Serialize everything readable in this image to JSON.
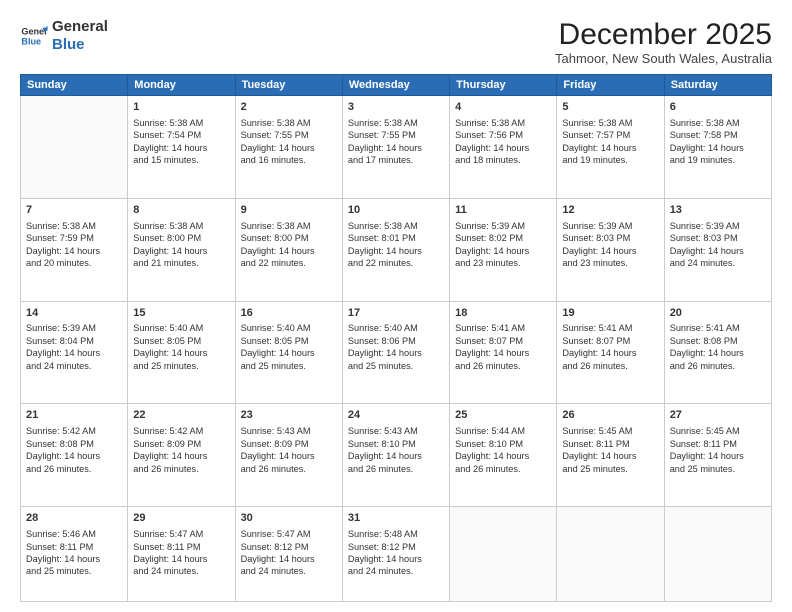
{
  "logo": {
    "general": "General",
    "blue": "Blue"
  },
  "header": {
    "month": "December 2025",
    "location": "Tahmoor, New South Wales, Australia"
  },
  "days_of_week": [
    "Sunday",
    "Monday",
    "Tuesday",
    "Wednesday",
    "Thursday",
    "Friday",
    "Saturday"
  ],
  "weeks": [
    [
      {
        "day": "",
        "info": ""
      },
      {
        "day": "1",
        "info": "Sunrise: 5:38 AM\nSunset: 7:54 PM\nDaylight: 14 hours\nand 15 minutes."
      },
      {
        "day": "2",
        "info": "Sunrise: 5:38 AM\nSunset: 7:55 PM\nDaylight: 14 hours\nand 16 minutes."
      },
      {
        "day": "3",
        "info": "Sunrise: 5:38 AM\nSunset: 7:55 PM\nDaylight: 14 hours\nand 17 minutes."
      },
      {
        "day": "4",
        "info": "Sunrise: 5:38 AM\nSunset: 7:56 PM\nDaylight: 14 hours\nand 18 minutes."
      },
      {
        "day": "5",
        "info": "Sunrise: 5:38 AM\nSunset: 7:57 PM\nDaylight: 14 hours\nand 19 minutes."
      },
      {
        "day": "6",
        "info": "Sunrise: 5:38 AM\nSunset: 7:58 PM\nDaylight: 14 hours\nand 19 minutes."
      }
    ],
    [
      {
        "day": "7",
        "info": "Sunrise: 5:38 AM\nSunset: 7:59 PM\nDaylight: 14 hours\nand 20 minutes."
      },
      {
        "day": "8",
        "info": "Sunrise: 5:38 AM\nSunset: 8:00 PM\nDaylight: 14 hours\nand 21 minutes."
      },
      {
        "day": "9",
        "info": "Sunrise: 5:38 AM\nSunset: 8:00 PM\nDaylight: 14 hours\nand 22 minutes."
      },
      {
        "day": "10",
        "info": "Sunrise: 5:38 AM\nSunset: 8:01 PM\nDaylight: 14 hours\nand 22 minutes."
      },
      {
        "day": "11",
        "info": "Sunrise: 5:39 AM\nSunset: 8:02 PM\nDaylight: 14 hours\nand 23 minutes."
      },
      {
        "day": "12",
        "info": "Sunrise: 5:39 AM\nSunset: 8:03 PM\nDaylight: 14 hours\nand 23 minutes."
      },
      {
        "day": "13",
        "info": "Sunrise: 5:39 AM\nSunset: 8:03 PM\nDaylight: 14 hours\nand 24 minutes."
      }
    ],
    [
      {
        "day": "14",
        "info": "Sunrise: 5:39 AM\nSunset: 8:04 PM\nDaylight: 14 hours\nand 24 minutes."
      },
      {
        "day": "15",
        "info": "Sunrise: 5:40 AM\nSunset: 8:05 PM\nDaylight: 14 hours\nand 25 minutes."
      },
      {
        "day": "16",
        "info": "Sunrise: 5:40 AM\nSunset: 8:05 PM\nDaylight: 14 hours\nand 25 minutes."
      },
      {
        "day": "17",
        "info": "Sunrise: 5:40 AM\nSunset: 8:06 PM\nDaylight: 14 hours\nand 25 minutes."
      },
      {
        "day": "18",
        "info": "Sunrise: 5:41 AM\nSunset: 8:07 PM\nDaylight: 14 hours\nand 26 minutes."
      },
      {
        "day": "19",
        "info": "Sunrise: 5:41 AM\nSunset: 8:07 PM\nDaylight: 14 hours\nand 26 minutes."
      },
      {
        "day": "20",
        "info": "Sunrise: 5:41 AM\nSunset: 8:08 PM\nDaylight: 14 hours\nand 26 minutes."
      }
    ],
    [
      {
        "day": "21",
        "info": "Sunrise: 5:42 AM\nSunset: 8:08 PM\nDaylight: 14 hours\nand 26 minutes."
      },
      {
        "day": "22",
        "info": "Sunrise: 5:42 AM\nSunset: 8:09 PM\nDaylight: 14 hours\nand 26 minutes."
      },
      {
        "day": "23",
        "info": "Sunrise: 5:43 AM\nSunset: 8:09 PM\nDaylight: 14 hours\nand 26 minutes."
      },
      {
        "day": "24",
        "info": "Sunrise: 5:43 AM\nSunset: 8:10 PM\nDaylight: 14 hours\nand 26 minutes."
      },
      {
        "day": "25",
        "info": "Sunrise: 5:44 AM\nSunset: 8:10 PM\nDaylight: 14 hours\nand 26 minutes."
      },
      {
        "day": "26",
        "info": "Sunrise: 5:45 AM\nSunset: 8:11 PM\nDaylight: 14 hours\nand 25 minutes."
      },
      {
        "day": "27",
        "info": "Sunrise: 5:45 AM\nSunset: 8:11 PM\nDaylight: 14 hours\nand 25 minutes."
      }
    ],
    [
      {
        "day": "28",
        "info": "Sunrise: 5:46 AM\nSunset: 8:11 PM\nDaylight: 14 hours\nand 25 minutes."
      },
      {
        "day": "29",
        "info": "Sunrise: 5:47 AM\nSunset: 8:11 PM\nDaylight: 14 hours\nand 24 minutes."
      },
      {
        "day": "30",
        "info": "Sunrise: 5:47 AM\nSunset: 8:12 PM\nDaylight: 14 hours\nand 24 minutes."
      },
      {
        "day": "31",
        "info": "Sunrise: 5:48 AM\nSunset: 8:12 PM\nDaylight: 14 hours\nand 24 minutes."
      },
      {
        "day": "",
        "info": ""
      },
      {
        "day": "",
        "info": ""
      },
      {
        "day": "",
        "info": ""
      }
    ]
  ]
}
